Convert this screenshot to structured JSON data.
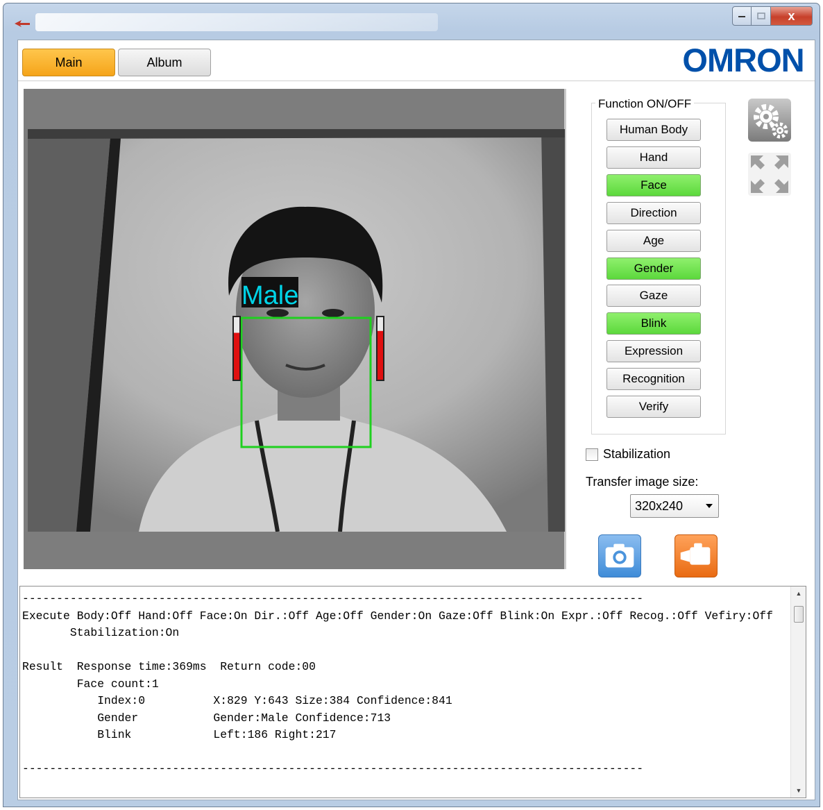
{
  "window": {
    "title": "",
    "controls": {
      "minimize": "minimize",
      "maximize": "maximize",
      "close": "x"
    }
  },
  "tabs": [
    {
      "label": "Main",
      "active": true
    },
    {
      "label": "Album",
      "active": false
    }
  ],
  "brand": {
    "logo_text": "OMRON",
    "color": "#0050aa"
  },
  "camera": {
    "overlay_label": "Male",
    "overlay_label_color": "#00d4e8",
    "face_box_color": "#1fd01f",
    "blink_left_level": 0.75,
    "blink_right_level": 0.78
  },
  "functions": {
    "title": "Function ON/OFF",
    "buttons": [
      {
        "label": "Human Body",
        "on": false
      },
      {
        "label": "Hand",
        "on": false
      },
      {
        "label": "Face",
        "on": true
      },
      {
        "label": "Direction",
        "on": false
      },
      {
        "label": "Age",
        "on": false
      },
      {
        "label": "Gender",
        "on": true
      },
      {
        "label": "Gaze",
        "on": false
      },
      {
        "label": "Blink",
        "on": true
      },
      {
        "label": "Expression",
        "on": false
      },
      {
        "label": "Recognition",
        "on": false
      },
      {
        "label": "Verify",
        "on": false
      }
    ],
    "on_color": "#66e045"
  },
  "icons": {
    "settings": "gear-icon",
    "fullscreen": "fullscreen-icon",
    "capture": "camera-icon",
    "record": "video-camera-icon"
  },
  "stabilization": {
    "label": "Stabilization",
    "checked": false
  },
  "transfer": {
    "label": "Transfer image size:",
    "selected": "320x240"
  },
  "log": {
    "lines": [
      "-------------------------------------------------------------------------------------------",
      "Execute Body:Off Hand:Off Face:On Dir.:Off Age:Off Gender:On Gaze:Off Blink:On Expr.:Off Recog.:Off Vefiry:Off",
      "       Stabilization:On",
      "",
      "Result  Response time:369ms  Return code:00",
      "        Face count:1",
      "           Index:0          X:829 Y:643 Size:384 Confidence:841",
      "           Gender           Gender:Male Confidence:713",
      "           Blink            Left:186 Right:217",
      "",
      "-------------------------------------------------------------------------------------------"
    ]
  }
}
